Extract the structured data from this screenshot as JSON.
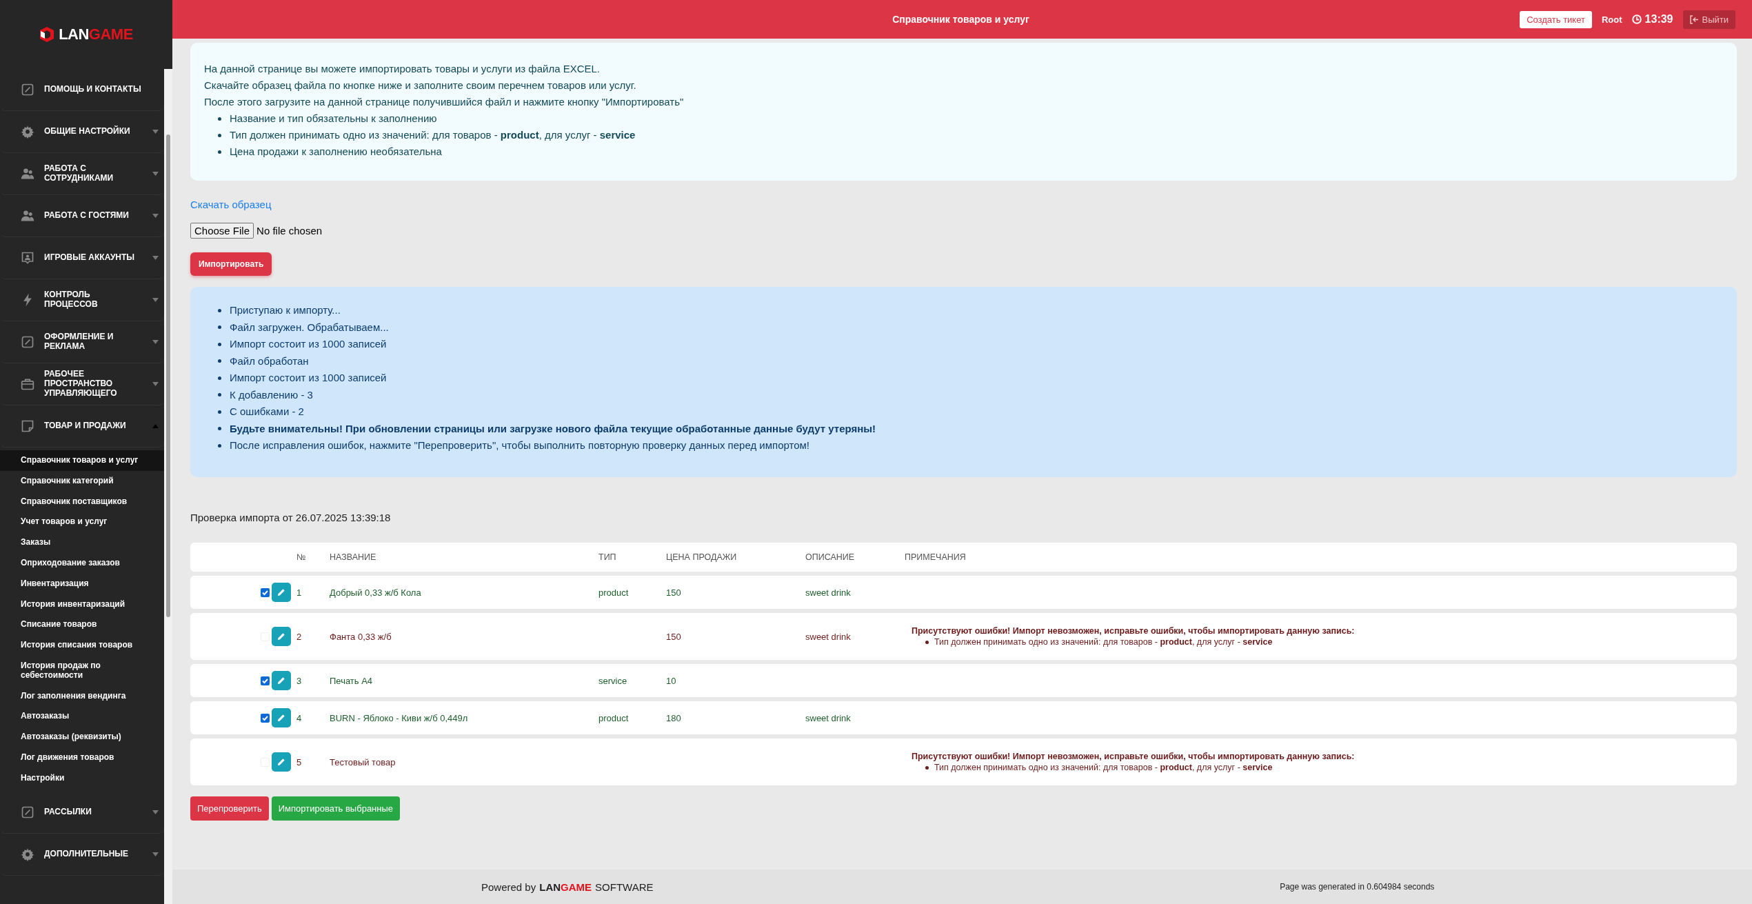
{
  "logo": {
    "first": "LAN",
    "second": "GAME"
  },
  "sidebar": {
    "items": [
      {
        "label": "ПОМОЩЬ И КОНТАКТЫ",
        "kind": "link"
      },
      {
        "label": "ОБЩИЕ НАСТРОЙКИ",
        "kind": "group",
        "expanded": false
      },
      {
        "label": "РАБОТА С СОТРУДНИКАМИ",
        "kind": "group",
        "expanded": false
      },
      {
        "label": "РАБОТА С ГОСТЯМИ",
        "kind": "group",
        "expanded": false
      },
      {
        "label": "ИГРОВЫЕ АККАУНТЫ",
        "kind": "group",
        "expanded": false
      },
      {
        "label": "КОНТРОЛЬ ПРОЦЕССОВ",
        "kind": "group",
        "expanded": false
      },
      {
        "label": "ОФОРМЛЕНИЕ И РЕКЛАМА",
        "kind": "group",
        "expanded": false
      },
      {
        "label": "РАБОЧЕЕ ПРОСТРАНСТВО УПРАВЛЯЮЩЕГО",
        "kind": "group",
        "expanded": false
      },
      {
        "label": "ТОВАР И ПРОДАЖИ",
        "kind": "group",
        "expanded": true,
        "children": [
          {
            "label": "Справочник товаров и услуг",
            "selected": true
          },
          {
            "label": "Справочник категорий",
            "selected": false
          },
          {
            "label": "Справочник поставщиков",
            "selected": false
          },
          {
            "label": "Учет товаров и услуг",
            "selected": false
          },
          {
            "label": "Заказы",
            "selected": false
          },
          {
            "label": "Оприходование заказов",
            "selected": false
          },
          {
            "label": "Инвентаризация",
            "selected": false
          },
          {
            "label": "История инвентаризаций",
            "selected": false
          },
          {
            "label": "Списание товаров",
            "selected": false
          },
          {
            "label": "История списания товаров",
            "selected": false
          },
          {
            "label": "История продаж по себестоимости",
            "selected": false
          },
          {
            "label": "Лог заполнения вендинга",
            "selected": false
          },
          {
            "label": "Автозаказы",
            "selected": false
          },
          {
            "label": "Автозаказы (реквизиты)",
            "selected": false
          },
          {
            "label": "Лог движения товаров",
            "selected": false
          },
          {
            "label": "Настройки",
            "selected": false
          }
        ]
      },
      {
        "label": "РАССЫЛКИ",
        "kind": "group",
        "expanded": false
      },
      {
        "label": "ДОПОЛНИТЕЛЬНЫЕ",
        "kind": "group",
        "expanded": false
      }
    ]
  },
  "header": {
    "title": "Справочник товаров и услуг",
    "ticket_button": "Создать тикет",
    "user": "Root",
    "time": "13:39",
    "logout_button": "Выйти"
  },
  "info": {
    "lines": [
      "На данной странице вы можете импортировать товары и услуги из файла EXCEL.",
      "Скачайте образец файла по кнопке ниже и заполните своим перечнем товаров или услуг.",
      "После этого загрузите на данной странице получившийся файл и нажмите кнопку \"Импортировать\""
    ],
    "bullets": [
      "Название и тип обязательны к заполнению",
      "Тип должен принимать одно из значений: для товаров - **product**, для услуг - **service**",
      "Цена продажи к заполнению необязательна"
    ]
  },
  "download_link": "Скачать образец",
  "file_input": {
    "button": "Choose File",
    "value": "No file chosen"
  },
  "import_button": "Импортировать",
  "log": [
    {
      "text": "Приступаю к импорту...",
      "important": false
    },
    {
      "text": "Файл загружен. Обрабатываем...",
      "important": false
    },
    {
      "text": "Импорт состоит из 1000 записей",
      "important": false
    },
    {
      "text": "Файл обработан",
      "important": false
    },
    {
      "text": "Импорт состоит из 1000 записей",
      "important": false
    },
    {
      "text": "К добавлению - 3",
      "important": false
    },
    {
      "text": "С ошибками - 2",
      "important": false
    },
    {
      "text": "Будьте внимательны! При обновлении страницы или загрузке нового файла текущие обработанные данные будут утеряны!",
      "important": true
    },
    {
      "text": "После исправления ошибок, нажмите \"Перепроверить\", чтобы выполнить повторную проверку данных перед импортом!",
      "important": false
    }
  ],
  "check_title": "Проверка импорта от 26.07.2025 13:39:18",
  "table": {
    "columns": [
      "№",
      "НАЗВАНИЕ",
      "ТИП",
      "ЦЕНА ПРОДАЖИ",
      "ОПИСАНИЕ",
      "ПРИМЕЧАНИЯ"
    ],
    "rows": [
      {
        "checked": true,
        "has_errors": false,
        "number": "1",
        "name": "Добрый 0,33 ж/б Кола",
        "type": "product",
        "price": "150",
        "description": "sweet drink"
      },
      {
        "checked": false,
        "has_errors": true,
        "number": "2",
        "name": "Фанта 0,33 ж/б",
        "price": "150",
        "description": "sweet drink",
        "note": {
          "title": "Присутствуют ошибки! Импорт **невозможен**, исправьте ошибки, чтобы импортировать данную запись:",
          "items": [
            "Тип должен принимать одно из значений: для товаров - **product**, для услуг - **service**"
          ]
        }
      },
      {
        "checked": true,
        "has_errors": false,
        "number": "3",
        "name": "Печать А4",
        "type": "service",
        "price": "10"
      },
      {
        "checked": true,
        "has_errors": false,
        "number": "4",
        "name": "BURN - Яблоко - Киви ж/б 0,449л",
        "type": "product",
        "price": "180",
        "description": "sweet drink"
      },
      {
        "checked": false,
        "has_errors": true,
        "number": "5",
        "name": "Тестовый товар",
        "note": {
          "title": "Присутствуют ошибки! Импорт **невозможен**, исправьте ошибки, чтобы импортировать данную запись:",
          "items": [
            "Тип должен принимать одно из значений: для товаров - **product**, для услуг - **service**"
          ]
        }
      }
    ]
  },
  "recheck_button": "Перепроверить",
  "import_selected_button": "Импортировать выбранные",
  "footer": {
    "powered_by": "Powered by",
    "brand_first": "LAN",
    "brand_second": "GAME",
    "brand_suffix": "SOFTWARE",
    "generated": "Page was generated in 0.604984 seconds"
  }
}
